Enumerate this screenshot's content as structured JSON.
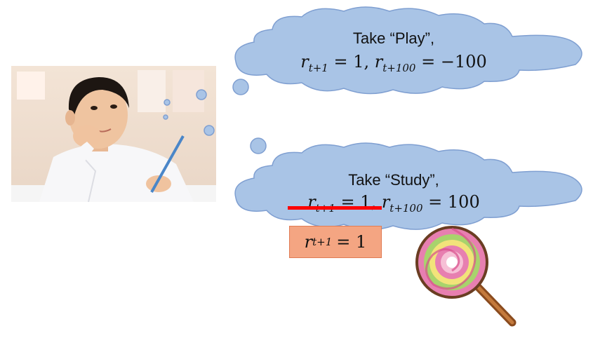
{
  "clouds": [
    {
      "label": "Take “Play”,",
      "reward_now": "= 1,",
      "reward_later": "= −100",
      "sub_now": "t+1",
      "sub_later": "t+100",
      "var": "r"
    },
    {
      "label": "Take “Study”,",
      "reward_now": "= 1,",
      "reward_later": "= 100",
      "sub_now": "t+1",
      "sub_later": "t+100",
      "var": "r"
    }
  ],
  "correction": {
    "var": "r",
    "sub": "t+1",
    "value": "= 1"
  },
  "colors": {
    "cloud_fill": "#a9c4e6",
    "cloud_stroke": "#7f9fd1",
    "strike": "#ff0000",
    "box_fill": "#f4a582"
  },
  "icons": {
    "photo": "boy-thinking-photo",
    "lollipop": "lollipop-icon"
  }
}
